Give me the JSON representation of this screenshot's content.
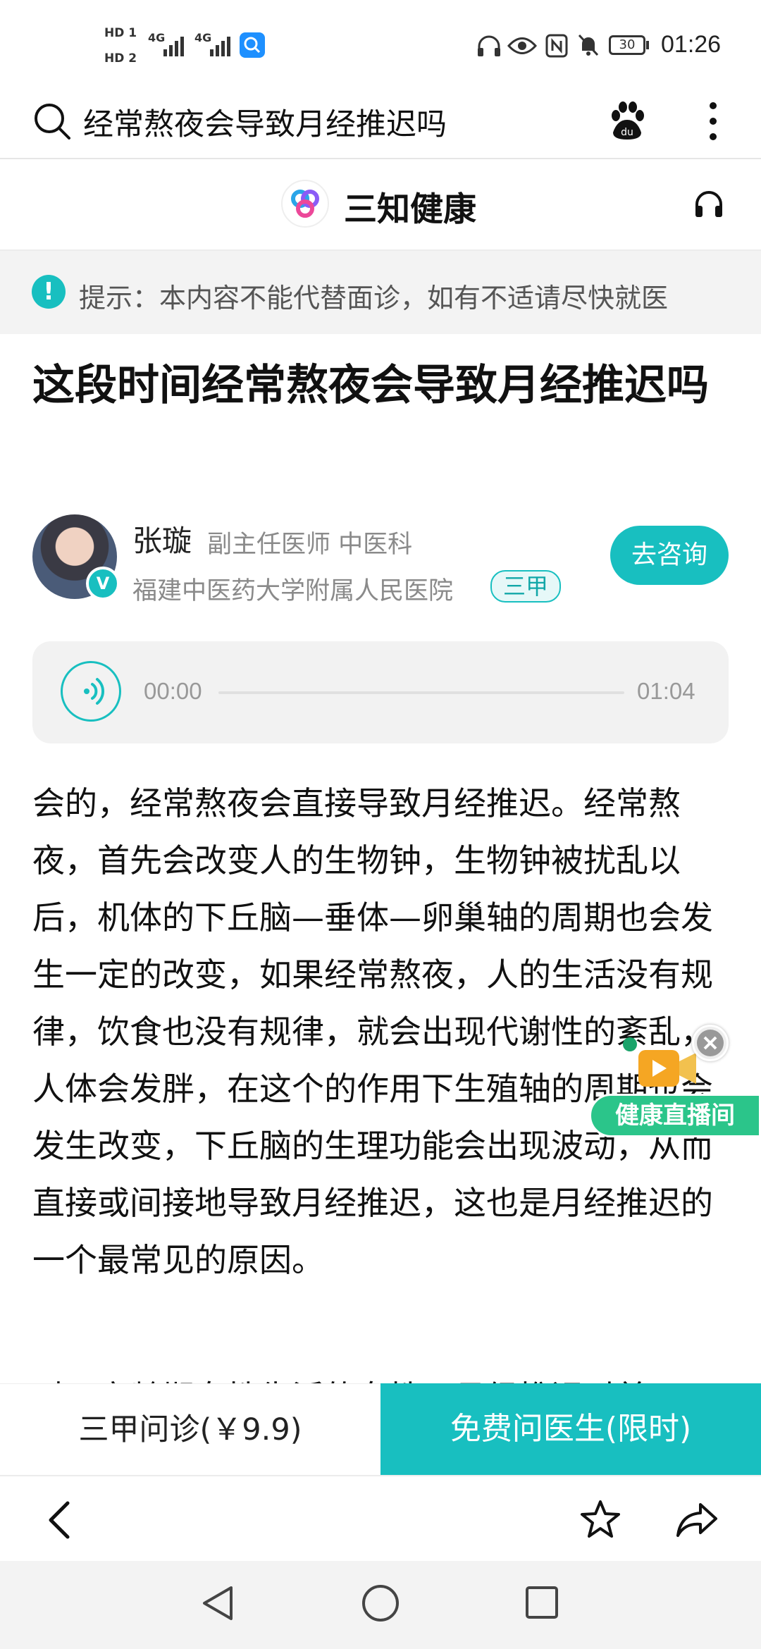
{
  "status_bar": {
    "sim1": "HD 1",
    "sim2": "HD 2",
    "net1": "4G",
    "net2": "4G",
    "battery": "30",
    "time": "01:26"
  },
  "search": {
    "query": "经常熬夜会导致月经推迟吗"
  },
  "header": {
    "brand": "三知健康"
  },
  "tip": {
    "icon": "!",
    "text": "提示：本内容不能代替面诊，如有不适请尽快就医"
  },
  "article": {
    "title": "这段时间经常熬夜会导致月经推迟吗",
    "doctor": {
      "name": "张璇",
      "title": "副主任医师  中医科",
      "hospital": "福建中医药大学附属人民医院",
      "level": "三甲",
      "verified": "V",
      "consult_label": "去咨询"
    },
    "audio": {
      "current": "00:00",
      "duration": "01:04",
      "progress": 0
    },
    "body": "会的，经常熬夜会直接导致月经推迟。经常熬夜，首先会改变人的生物钟，生物钟被扰乱以后，机体的下丘脑—垂体—卵巢轴的周期也会发生一定的改变，如果经常熬夜，人的生活没有规律，饮食也没有规律，就会出现代谢性的紊乱，人体会发胖，在这个的作用下生殖轴的周期也会发生改变，下丘脑的生理功能会出现波动，从而直接或间接地导致月经推迟，这也是月经推迟的一个最常见的原因。",
    "body_next": "对于育龄期女性生活的女性，月经推迟时首"
  },
  "live_widget": {
    "label": "健康直播间"
  },
  "actions": {
    "paid_consult": "三甲问诊(￥9.9)",
    "free_consult": "免费问医生(限时)"
  },
  "colors": {
    "accent": "#18bfc0",
    "live_green": "#2bc58a"
  }
}
